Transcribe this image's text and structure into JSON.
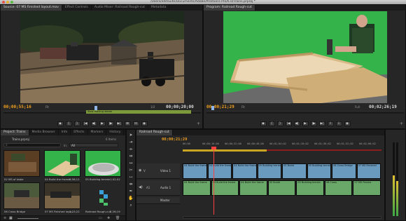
{
  "window": {
    "title": "/Users/editsuite/Documents/Adobe/Premiere Pro/6.0/Trains.prproj *"
  },
  "source_monitor": {
    "tabs": [
      "Source: 07 MS Finished layout.mov",
      "Effect Controls",
      "Audio Mixer: Railroad Rough-cut",
      "Metadata"
    ],
    "timecode_in": "00;00;55;16",
    "fit": "Fit",
    "resolution": "1/2",
    "timecode_out": "00;00;20;00",
    "marker_label": "Slow moving steam"
  },
  "program_monitor": {
    "tab": "Program: Railroad Rough-cut",
    "timecode_in": "00;00;21;29",
    "fit": "Fit",
    "resolution": "Full",
    "timecode_out": "00;02;26;19"
  },
  "controls": {
    "source": [
      "◆",
      "{",
      "}",
      "|◀",
      "◀|",
      "▶",
      "|▶",
      "▶|",
      "⊞",
      "⊡",
      "◉",
      "+"
    ],
    "program": [
      "◆",
      "{",
      "}",
      "|◀",
      "◀|",
      "▶",
      "|▶",
      "▶|",
      "⇪",
      "⇩",
      "◉",
      "+"
    ]
  },
  "project": {
    "tabs": [
      "Project: Trains",
      "Media Browser",
      "Info",
      "Effects",
      "Markers",
      "History"
    ],
    "file": "Trains.prproj",
    "item_count": "6 Items",
    "in_label": "In:",
    "in_value": "All",
    "items": [
      {
        "name": "02 MS of table",
        "duration": "2;18;12"
      },
      {
        "name": "04 Build the frame",
        "duration": "6;56;11"
      },
      {
        "name": "05 Building terrain",
        "duration": "1;02;02"
      },
      {
        "name": "06 Cross Bridge",
        "duration": "2;14;27"
      },
      {
        "name": "07 MS Finished layo...",
        "duration": "1;23;22"
      },
      {
        "name": "Railroad Rough-cut",
        "duration": "2;26;19"
      }
    ]
  },
  "timeline": {
    "tab": "Railroad Rough-cut",
    "timecode": "00;00;21;29",
    "ruler": [
      "00;00",
      "00;00;16;00",
      "00;00;32;00",
      "00;00;48;00",
      "00;01;04;02",
      "00;01;20;02",
      "00;01;36;02",
      "00;01;52;02",
      "00;02;08;02",
      "00;02;24;02"
    ],
    "tracks": {
      "video": "Video 1",
      "audio": "Audio 1",
      "master": "Master",
      "video_label": "V",
      "audio_label": "A1"
    },
    "video_clips": [
      "04 Build the frame",
      "04 Build the frame",
      "04 Build the frame",
      "05 Building terrain",
      "05 Buildi",
      "05 Building terrain",
      "06 Cross Bridge",
      "07 MS Finished"
    ],
    "audio_clips": [
      "04 Build the frame",
      "04 Build the frame",
      "04 Build the frame",
      "05 Buildi",
      "05 Building terrain",
      "06 Cross",
      "07 MS Finishe"
    ]
  },
  "tools": [
    "arrow",
    "track-select",
    "ripple",
    "rolling",
    "rate-stretch",
    "razor",
    "slip",
    "slide",
    "pen",
    "hand",
    "zoom"
  ],
  "colors": {
    "accent_timecode": "#f0a020",
    "video_clip": "#6a9bbf",
    "audio_clip": "#6aa86a",
    "work_area": "#c9a524",
    "playhead": "#ff4040"
  }
}
